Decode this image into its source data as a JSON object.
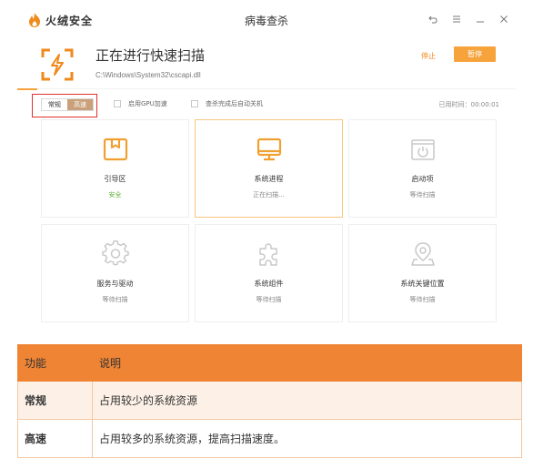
{
  "titlebar": {
    "brand": "火绒安全",
    "title": "病毒查杀",
    "controls": [
      "back-icon",
      "menu-icon",
      "minimize-icon",
      "close-icon"
    ]
  },
  "scan": {
    "title": "正在进行快速扫描",
    "path": "C:\\Windows\\System32\\cscapi.dll",
    "stop_label": "停止",
    "pause_label": "暂停",
    "progress_fraction": 0.04,
    "accent": "#f6a33c"
  },
  "options": {
    "mode_normal": "常规",
    "mode_fast": "高速",
    "gpu_label": "启用GPU加速",
    "shutdown_label": "查杀完成后自动关机",
    "elapsed": "已用时间：00:00:01"
  },
  "items": [
    {
      "name": "引导区",
      "status": "安全",
      "icon": "boot-sector-icon"
    },
    {
      "name": "系统进程",
      "status": "正在扫描...",
      "icon": "monitor-icon"
    },
    {
      "name": "启动项",
      "status": "等待扫描",
      "icon": "power-icon"
    },
    {
      "name": "服务与驱动",
      "status": "等待扫描",
      "icon": "gear-icon"
    },
    {
      "name": "系统组件",
      "status": "等待扫描",
      "icon": "puzzle-icon"
    },
    {
      "name": "系统关键位置",
      "status": "等待扫描",
      "icon": "location-icon"
    }
  ],
  "table": {
    "headers": [
      "功能",
      "说明"
    ],
    "rows": [
      [
        "常规",
        "占用较少的系统资源"
      ],
      [
        "高速",
        "占用较多的系统资源，提高扫描速度。"
      ]
    ],
    "header_color": "#ee8434"
  }
}
